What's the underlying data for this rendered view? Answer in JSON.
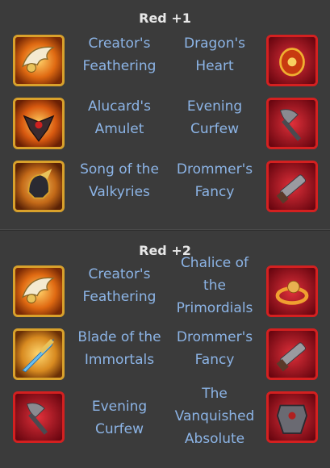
{
  "sections": [
    {
      "title": "Red +1",
      "rows": [
        {
          "left": {
            "name": "Creator's\nFeathering",
            "icon": "winged-emblem-icon",
            "frame": "gold"
          },
          "right": {
            "name": "Dragon's\nHeart",
            "icon": "dragon-heart-icon",
            "frame": "red"
          }
        },
        {
          "left": {
            "name": "Alucard's\nAmulet",
            "icon": "amulet-icon",
            "frame": "gold"
          },
          "right": {
            "name": "Evening\nCurfew",
            "icon": "war-axe-icon",
            "frame": "red"
          }
        },
        {
          "left": {
            "name": "Song of the\nValkyries",
            "icon": "valkyrie-helmet-icon",
            "frame": "gold"
          },
          "right": {
            "name": "Drommer's\nFancy",
            "icon": "hand-cannon-icon",
            "frame": "red"
          }
        }
      ]
    },
    {
      "title": "Red +2",
      "rows": [
        {
          "left": {
            "name": "Creator's\nFeathering",
            "icon": "winged-emblem-icon",
            "frame": "gold"
          },
          "right": {
            "name": "Chalice of\nthe\nPrimordials",
            "icon": "skull-ring-icon",
            "frame": "red"
          }
        },
        {
          "left": {
            "name": "Blade of the\nImmortals",
            "icon": "glowing-sword-icon",
            "frame": "gold"
          },
          "right": {
            "name": "Drommer's\nFancy",
            "icon": "hand-cannon-icon",
            "frame": "red"
          }
        },
        {
          "left": {
            "name": "Evening\nCurfew",
            "icon": "war-axe-icon",
            "frame": "red"
          },
          "right": {
            "name": "The\nVanquished\nAbsolute",
            "icon": "armor-icon",
            "frame": "red"
          }
        }
      ]
    }
  ],
  "colors": {
    "background": "#3b3b3b",
    "title": "#e8e8e8",
    "item_name": "#8cb4e6",
    "gold_frame": "#d9a12b",
    "red_frame": "#d42020"
  }
}
